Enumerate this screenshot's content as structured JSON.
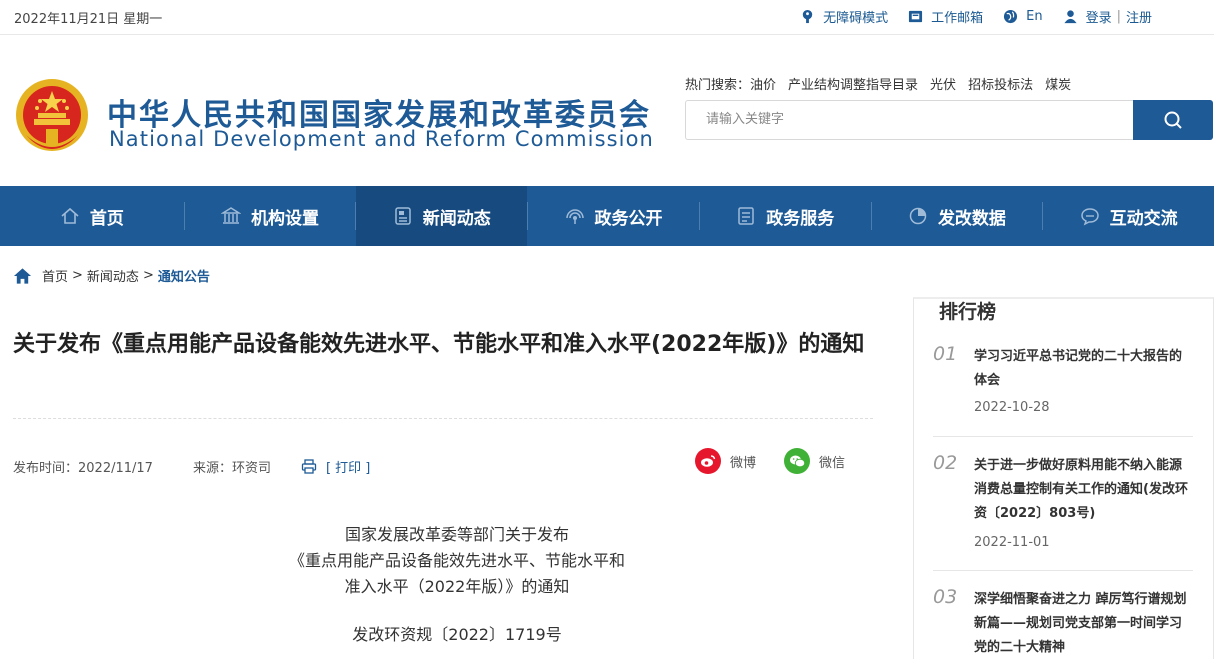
{
  "topbar": {
    "date": "2022年11月21日 星期一",
    "accessibility": "无障碍模式",
    "mail": "工作邮箱",
    "lang": "En",
    "login": "登录",
    "register": "注册"
  },
  "header": {
    "title_cn": "中华人民共和国国家发展和改革委员会",
    "title_en": "National Development and Reform Commission",
    "hot_label": "热门搜索：",
    "hot_terms": [
      "油价",
      "产业结构调整指导目录",
      "光伏",
      "招标投标法",
      "煤炭"
    ],
    "search_placeholder": "请输入关键字"
  },
  "nav": {
    "items": [
      "首页",
      "机构设置",
      "新闻动态",
      "政务公开",
      "政务服务",
      "发改数据",
      "互动交流"
    ],
    "active": "新闻动态"
  },
  "breadcrumb": {
    "home": "首页",
    "sep": ">",
    "news": "新闻动态",
    "current": "通知公告"
  },
  "article": {
    "title": "关于发布《重点用能产品设备能效先进水平、节能水平和准入水平(2022年版)》的通知",
    "publish": "发布时间：2022/11/17",
    "source": "来源：环资司",
    "print": "[ 打印 ]",
    "share_weibo": "微博",
    "share_wechat": "微信",
    "body_head": [
      "国家发展改革委等部门关于发布",
      "《重点用能产品设备能效先进水平、节能水平和",
      "准入水平（2022年版）》的通知"
    ],
    "doc_no": "发改环资规〔2022〕1719号"
  },
  "ranking": {
    "title": "排行榜",
    "items": [
      {
        "num": "01",
        "title": "学习习近平总书记党的二十大报告的体会",
        "date": "2022-10-28"
      },
      {
        "num": "02",
        "title": "关于进一步做好原料用能不纳入能源消费总量控制有关工作的通知(发改环资〔2022〕803号)",
        "date": "2022-11-01"
      },
      {
        "num": "03",
        "title": "深学细悟聚奋进之力 踔厉笃行谱规划新篇——规划司党支部第一时间学习党的二十大精神",
        "date": ""
      }
    ]
  },
  "colors": {
    "brand": "#1e5a96",
    "nav_active": "#174b80",
    "weibo": "#e6162d",
    "wechat": "#3fb136"
  }
}
